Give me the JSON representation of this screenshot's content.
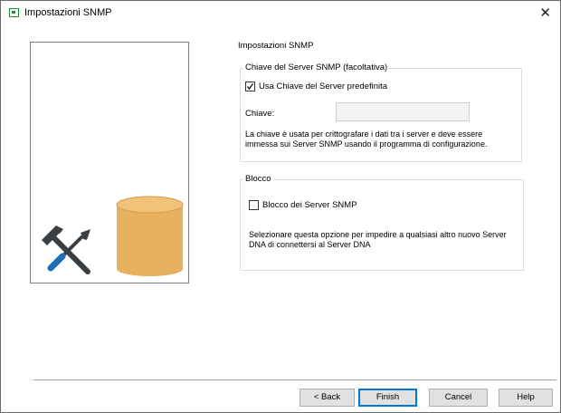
{
  "window": {
    "title": "Impostazioni SNMP"
  },
  "page": {
    "heading": "Impostazioni SNMP"
  },
  "key_group": {
    "label": "Chiave del Server SNMP (facoltativa)",
    "use_default_label": "Usa Chiave del Server predefinita",
    "use_default_checked": true,
    "key_label": "Chiave:",
    "key_value": "",
    "description": "La chiave è usata per crittografare i dati tra i server e deve essere immessa sui Server SNMP usando il programma di configurazione."
  },
  "lock_group": {
    "label": "Blocco",
    "lock_label": "Blocco dei Server SNMP",
    "lock_checked": false,
    "description": "Selezionare questa opzione per impedire a qualsiasi altro nuovo Server DNA di connettersi al Server DNA"
  },
  "buttons": {
    "back": "< Back",
    "finish": "Finish",
    "cancel": "Cancel",
    "help": "Help"
  },
  "colors": {
    "database": "#e8b15f",
    "screwdriver": "#1f6fb8",
    "tool_dark": "#3a3f44",
    "accent": "#0078d7"
  },
  "icons": {
    "app": "app-window-icon",
    "close": "close-icon",
    "database": "database-icon",
    "tools": "tools-icon"
  }
}
